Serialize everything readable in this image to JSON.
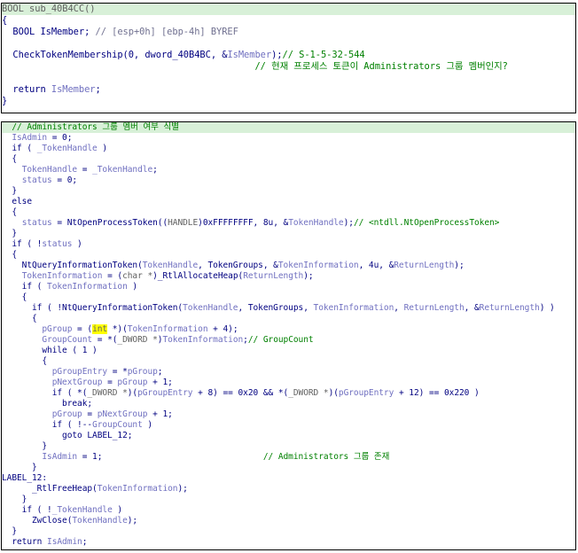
{
  "panel1": {
    "lines": [
      {
        "segments": [
          {
            "text": "BOOL sub_40B4CC()",
            "cls": "gray"
          }
        ],
        "hl": true
      },
      {
        "segments": [
          {
            "text": "{",
            "cls": "t"
          }
        ]
      },
      {
        "segments": [
          {
            "text": "  BOOL IsMember; ",
            "cls": "t"
          },
          {
            "text": "// [esp+0h] [ebp-4h] BYREF",
            "cls": "cm"
          }
        ]
      },
      {
        "segments": [
          {
            "text": "",
            "cls": "t"
          }
        ]
      },
      {
        "segments": [
          {
            "text": "  CheckTokenMembership(0, dword_40B4BC, &",
            "cls": "t"
          },
          {
            "text": "IsMember",
            "cls": "v"
          },
          {
            "text": ");",
            "cls": "t"
          },
          {
            "text": "// S-1-5-32-544",
            "cls": "c"
          }
        ]
      },
      {
        "segments": [
          {
            "text": "                                              // 현재 프로세스 토큰이 Administrators 그룹 멤버인지?",
            "cls": "c"
          }
        ]
      },
      {
        "segments": [
          {
            "text": "",
            "cls": "t"
          }
        ]
      },
      {
        "segments": [
          {
            "text": "  return ",
            "cls": "t"
          },
          {
            "text": "IsMember",
            "cls": "v"
          },
          {
            "text": ";",
            "cls": "t"
          }
        ]
      },
      {
        "segments": [
          {
            "text": "}",
            "cls": "t"
          }
        ]
      }
    ]
  },
  "panel2": {
    "lines": [
      {
        "segments": [
          {
            "text": "  // Administrators 그룹 멤버 여부 식별",
            "cls": "c"
          }
        ],
        "hl": true
      },
      {
        "segments": [
          {
            "text": "  ",
            "cls": "t"
          },
          {
            "text": "IsAdmin",
            "cls": "v"
          },
          {
            "text": " = 0;",
            "cls": "t"
          }
        ]
      },
      {
        "segments": [
          {
            "text": "  if ( ",
            "cls": "t"
          },
          {
            "text": "_TokenHandle",
            "cls": "v"
          },
          {
            "text": " )",
            "cls": "t"
          }
        ]
      },
      {
        "segments": [
          {
            "text": "  {",
            "cls": "t"
          }
        ]
      },
      {
        "segments": [
          {
            "text": "    ",
            "cls": "t"
          },
          {
            "text": "TokenHandle",
            "cls": "v"
          },
          {
            "text": " = ",
            "cls": "t"
          },
          {
            "text": "_TokenHandle",
            "cls": "v"
          },
          {
            "text": ";",
            "cls": "t"
          }
        ]
      },
      {
        "segments": [
          {
            "text": "    ",
            "cls": "t"
          },
          {
            "text": "status",
            "cls": "v"
          },
          {
            "text": " = 0;",
            "cls": "t"
          }
        ]
      },
      {
        "segments": [
          {
            "text": "  }",
            "cls": "t"
          }
        ]
      },
      {
        "segments": [
          {
            "text": "  else",
            "cls": "t"
          }
        ]
      },
      {
        "segments": [
          {
            "text": "  {",
            "cls": "t"
          }
        ]
      },
      {
        "segments": [
          {
            "text": "    ",
            "cls": "t"
          },
          {
            "text": "status",
            "cls": "v"
          },
          {
            "text": " = NtOpenProcessToken((",
            "cls": "t"
          },
          {
            "text": "HANDLE",
            "cls": "gray"
          },
          {
            "text": ")0xFFFFFFFF, 8u, &",
            "cls": "t"
          },
          {
            "text": "TokenHandle",
            "cls": "v"
          },
          {
            "text": ");",
            "cls": "t"
          },
          {
            "text": "// <ntdll.NtOpenProcessToken>",
            "cls": "c"
          }
        ]
      },
      {
        "segments": [
          {
            "text": "  }",
            "cls": "t"
          }
        ]
      },
      {
        "segments": [
          {
            "text": "  if ( !",
            "cls": "t"
          },
          {
            "text": "status",
            "cls": "v"
          },
          {
            "text": " )",
            "cls": "t"
          }
        ]
      },
      {
        "segments": [
          {
            "text": "  {",
            "cls": "t"
          }
        ]
      },
      {
        "segments": [
          {
            "text": "    NtQueryInformationToken(",
            "cls": "t"
          },
          {
            "text": "TokenHandle",
            "cls": "v"
          },
          {
            "text": ", TokenGroups, &",
            "cls": "t"
          },
          {
            "text": "TokenInformation",
            "cls": "v"
          },
          {
            "text": ", 4u, &",
            "cls": "t"
          },
          {
            "text": "ReturnLength",
            "cls": "v"
          },
          {
            "text": ");",
            "cls": "t"
          }
        ]
      },
      {
        "segments": [
          {
            "text": "    ",
            "cls": "t"
          },
          {
            "text": "TokenInformation",
            "cls": "v"
          },
          {
            "text": " = (",
            "cls": "t"
          },
          {
            "text": "char *",
            "cls": "gray"
          },
          {
            "text": ")_RtlAllocateHeap(",
            "cls": "t"
          },
          {
            "text": "ReturnLength",
            "cls": "v"
          },
          {
            "text": ");",
            "cls": "t"
          }
        ]
      },
      {
        "segments": [
          {
            "text": "    if ( ",
            "cls": "t"
          },
          {
            "text": "TokenInformation",
            "cls": "v"
          },
          {
            "text": " )",
            "cls": "t"
          }
        ]
      },
      {
        "segments": [
          {
            "text": "    {",
            "cls": "t"
          }
        ]
      },
      {
        "segments": [
          {
            "text": "      if ( !NtQueryInformationToken(",
            "cls": "t"
          },
          {
            "text": "TokenHandle",
            "cls": "v"
          },
          {
            "text": ", TokenGroups, ",
            "cls": "t"
          },
          {
            "text": "TokenInformation",
            "cls": "v"
          },
          {
            "text": ", ",
            "cls": "t"
          },
          {
            "text": "ReturnLength",
            "cls": "v"
          },
          {
            "text": ", &",
            "cls": "t"
          },
          {
            "text": "ReturnLength",
            "cls": "v"
          },
          {
            "text": ") )",
            "cls": "t"
          }
        ]
      },
      {
        "segments": [
          {
            "text": "      {",
            "cls": "t"
          }
        ]
      },
      {
        "segments": [
          {
            "text": "        ",
            "cls": "t"
          },
          {
            "text": "pGroup",
            "cls": "v"
          },
          {
            "text": " = (",
            "cls": "t"
          },
          {
            "text": "int",
            "cls": "gray mark"
          },
          {
            "text": " *)(",
            "cls": "t"
          },
          {
            "text": "TokenInformation",
            "cls": "v"
          },
          {
            "text": " + 4);",
            "cls": "t"
          }
        ]
      },
      {
        "segments": [
          {
            "text": "        ",
            "cls": "t"
          },
          {
            "text": "GroupCount",
            "cls": "v"
          },
          {
            "text": " = *(",
            "cls": "t"
          },
          {
            "text": "_DWORD *",
            "cls": "gray"
          },
          {
            "text": ")",
            "cls": "t"
          },
          {
            "text": "TokenInformation",
            "cls": "v"
          },
          {
            "text": ";",
            "cls": "t"
          },
          {
            "text": "// GroupCount",
            "cls": "c"
          }
        ]
      },
      {
        "segments": [
          {
            "text": "        while ( 1 )",
            "cls": "t"
          }
        ]
      },
      {
        "segments": [
          {
            "text": "        {",
            "cls": "t"
          }
        ]
      },
      {
        "segments": [
          {
            "text": "          ",
            "cls": "t"
          },
          {
            "text": "pGroupEntry",
            "cls": "v"
          },
          {
            "text": " = *",
            "cls": "t"
          },
          {
            "text": "pGroup",
            "cls": "v"
          },
          {
            "text": ";",
            "cls": "t"
          }
        ]
      },
      {
        "segments": [
          {
            "text": "          ",
            "cls": "t"
          },
          {
            "text": "pNextGroup",
            "cls": "v"
          },
          {
            "text": " = ",
            "cls": "t"
          },
          {
            "text": "pGroup",
            "cls": "v"
          },
          {
            "text": " + 1;",
            "cls": "t"
          }
        ]
      },
      {
        "segments": [
          {
            "text": "          if ( *(",
            "cls": "t"
          },
          {
            "text": "_DWORD *",
            "cls": "gray"
          },
          {
            "text": ")(",
            "cls": "t"
          },
          {
            "text": "pGroupEntry",
            "cls": "v"
          },
          {
            "text": " + 8) == 0x20 && *(",
            "cls": "t"
          },
          {
            "text": "_DWORD *",
            "cls": "gray"
          },
          {
            "text": ")(",
            "cls": "t"
          },
          {
            "text": "pGroupEntry",
            "cls": "v"
          },
          {
            "text": " + 12) == 0x220 )",
            "cls": "t"
          }
        ]
      },
      {
        "segments": [
          {
            "text": "            break;",
            "cls": "t"
          }
        ]
      },
      {
        "segments": [
          {
            "text": "          ",
            "cls": "t"
          },
          {
            "text": "pGroup",
            "cls": "v"
          },
          {
            "text": " = ",
            "cls": "t"
          },
          {
            "text": "pNextGroup",
            "cls": "v"
          },
          {
            "text": " + 1;",
            "cls": "t"
          }
        ]
      },
      {
        "segments": [
          {
            "text": "          if ( !--",
            "cls": "t"
          },
          {
            "text": "GroupCount",
            "cls": "v"
          },
          {
            "text": " )",
            "cls": "t"
          }
        ]
      },
      {
        "segments": [
          {
            "text": "            goto LABEL_12;",
            "cls": "t"
          }
        ]
      },
      {
        "segments": [
          {
            "text": "        }",
            "cls": "t"
          }
        ]
      },
      {
        "segments": [
          {
            "text": "        ",
            "cls": "t"
          },
          {
            "text": "IsAdmin",
            "cls": "v"
          },
          {
            "text": " = 1;",
            "cls": "t"
          },
          {
            "text": "                                // Administrators 그룹 존재",
            "cls": "c"
          }
        ]
      },
      {
        "segments": [
          {
            "text": "      }",
            "cls": "t"
          }
        ]
      },
      {
        "segments": [
          {
            "text": "LABEL_12:",
            "cls": "t"
          }
        ]
      },
      {
        "segments": [
          {
            "text": "      _RtlFreeHeap(",
            "cls": "t"
          },
          {
            "text": "TokenInformation",
            "cls": "v"
          },
          {
            "text": ");",
            "cls": "t"
          }
        ]
      },
      {
        "segments": [
          {
            "text": "    }",
            "cls": "t"
          }
        ]
      },
      {
        "segments": [
          {
            "text": "    if ( !",
            "cls": "t"
          },
          {
            "text": "_TokenHandle",
            "cls": "v"
          },
          {
            "text": " )",
            "cls": "t"
          }
        ]
      },
      {
        "segments": [
          {
            "text": "      ZwClose(",
            "cls": "t"
          },
          {
            "text": "TokenHandle",
            "cls": "v"
          },
          {
            "text": ");",
            "cls": "t"
          }
        ]
      },
      {
        "segments": [
          {
            "text": "  }",
            "cls": "t"
          }
        ]
      },
      {
        "segments": [
          {
            "text": "  return ",
            "cls": "t"
          },
          {
            "text": "IsAdmin",
            "cls": "v"
          },
          {
            "text": ";",
            "cls": "t"
          }
        ]
      }
    ]
  }
}
